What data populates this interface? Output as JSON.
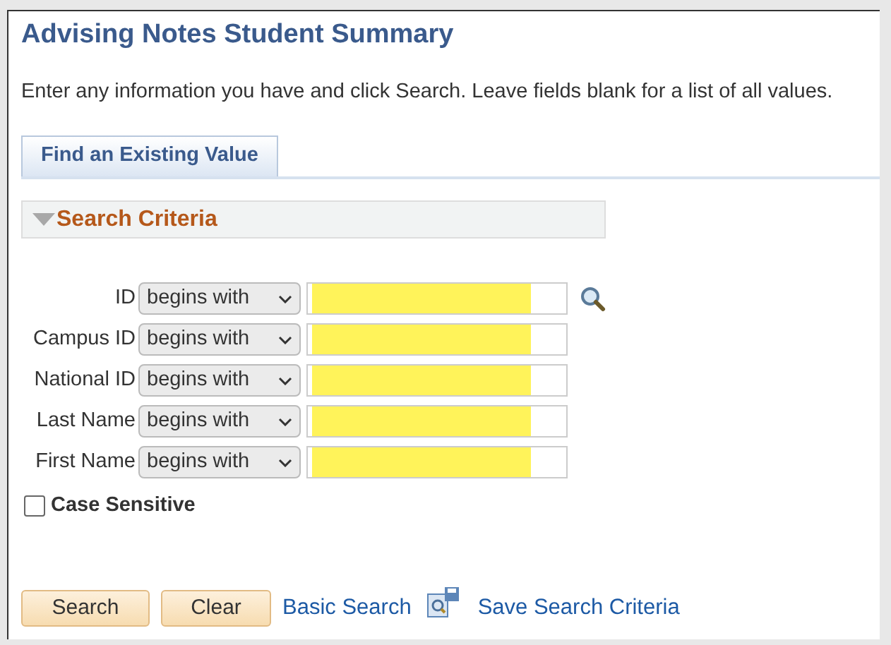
{
  "page": {
    "title": "Advising Notes Student Summary",
    "instructions": "Enter any information you have and click Search. Leave fields blank for a list of all values."
  },
  "tabs": [
    {
      "label": "Find an Existing Value",
      "selected": true
    }
  ],
  "search_criteria": {
    "title": "Search Criteria",
    "expanded": true
  },
  "fields": [
    {
      "label": "ID",
      "operator": "begins with",
      "highlighted": true,
      "lookup": true
    },
    {
      "label": "Campus ID",
      "operator": "begins with",
      "highlighted": true,
      "lookup": false
    },
    {
      "label": "National ID",
      "operator": "begins with",
      "highlighted": true,
      "lookup": false
    },
    {
      "label": "Last Name",
      "operator": "begins with",
      "highlighted": true,
      "lookup": false
    },
    {
      "label": "First Name",
      "operator": "begins with",
      "highlighted": true,
      "lookup": false
    }
  ],
  "case_sensitive": {
    "label": "Case Sensitive",
    "checked": false
  },
  "buttons": [
    "Search",
    "Clear"
  ],
  "links": [
    {
      "label": "Basic Search",
      "icon": false
    },
    {
      "label": "Save Search Criteria",
      "icon": true
    }
  ]
}
